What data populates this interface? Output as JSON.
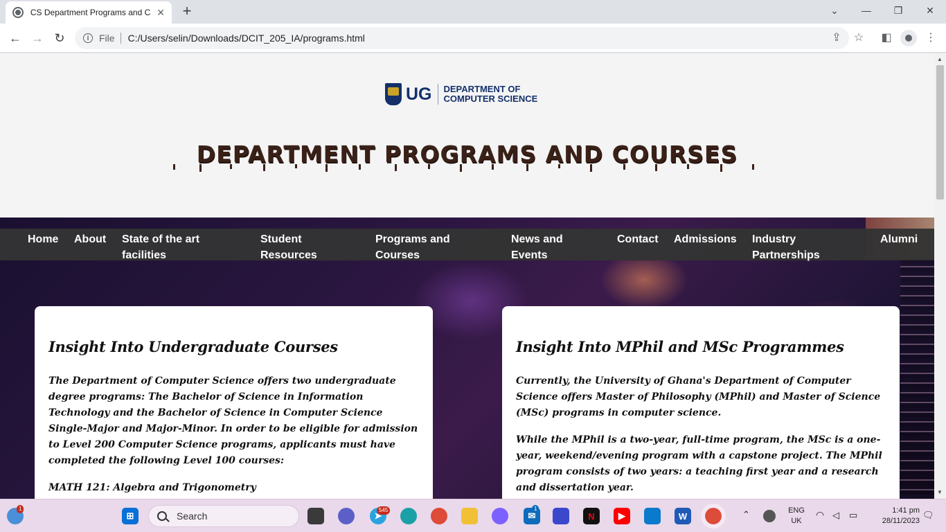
{
  "browser": {
    "tab_title": "CS Department Programs and C",
    "url_label": "File",
    "url": "C:/Users/selin/Downloads/DCIT_205_IA/programs.html"
  },
  "logo": {
    "short": "UG",
    "line1": "DEPARTMENT OF",
    "line2": "COMPUTER SCIENCE"
  },
  "page": {
    "title": "DEPARTMENT PROGRAMS AND COURSES"
  },
  "nav": {
    "home": "Home",
    "about": "About",
    "facilities_1": "State of the art",
    "facilities_2": "facilities",
    "resources_1": "Student",
    "resources_2": "Resources",
    "programs_1": "Programs and",
    "programs_2": "Courses",
    "news_1": "News and",
    "news_2": "Events",
    "contact": "Contact",
    "admissions": "Admissions",
    "industry_1": "Industry",
    "industry_2": "Partnerships",
    "alumni": "Alumni"
  },
  "undergrad": {
    "heading": "Insight Into Undergraduate Courses",
    "para1": "The Department of Computer Science offers two undergraduate degree programs: The Bachelor of Science in Information Technology and the Bachelor of Science in Computer Science Single-Major and Major-Minor. In order to be eligible for admission to Level 200 Computer Science programs, applicants must have completed the following Level 100 courses:",
    "para2": "MATH 121: Algebra and Trigonometry"
  },
  "postgrad": {
    "heading": "Insight Into MPhil and MSc Programmes",
    "para1": "Currently, the University of Ghana's Department of Computer Science offers Master of Philosophy (MPhil) and Master of Science (MSc) programs in computer science.",
    "para2": "While the MPhil is a two-year, full-time program, the MSc is a one-year, weekend/evening program with a capstone project. The MPhil program consists of two years: a teaching first year and a research and dissertation year."
  },
  "taskbar": {
    "search_placeholder": "Search",
    "widgets_badge": "1",
    "telegram_badge": "545",
    "mail_badge": "1",
    "lang_1": "ENG",
    "lang_2": "UK",
    "time": "1:41 pm",
    "date": "28/11/2023"
  },
  "colors": {
    "nav_bg": "#333333",
    "title_color": "#3a2118",
    "ug_blue": "#14306b"
  }
}
